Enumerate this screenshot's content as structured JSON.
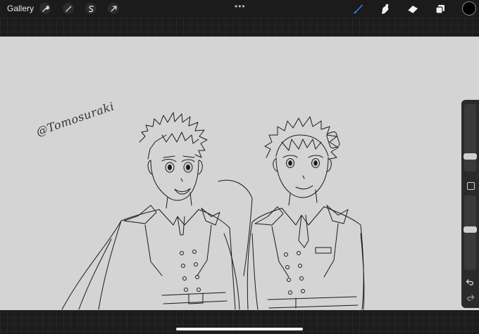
{
  "topbar": {
    "gallery_label": "Gallery",
    "left_tools": [
      {
        "name": "wrench-icon"
      },
      {
        "name": "magic-wand-icon"
      },
      {
        "name": "selection-icon"
      },
      {
        "name": "transform-arrow-icon"
      }
    ],
    "more_dots": "•••",
    "right_tools": [
      {
        "name": "brush-icon",
        "active": true
      },
      {
        "name": "smudge-icon"
      },
      {
        "name": "eraser-icon"
      },
      {
        "name": "layers-icon"
      }
    ],
    "current_color": "#000000",
    "accent_color": "#3a84ff"
  },
  "canvas": {
    "signature": "@Tomosuraki",
    "background": "#d4d4d4",
    "line_color": "#1a1a1a"
  },
  "sidebar": {
    "brush_size_level": 0.2,
    "opacity_level": 0.55
  }
}
